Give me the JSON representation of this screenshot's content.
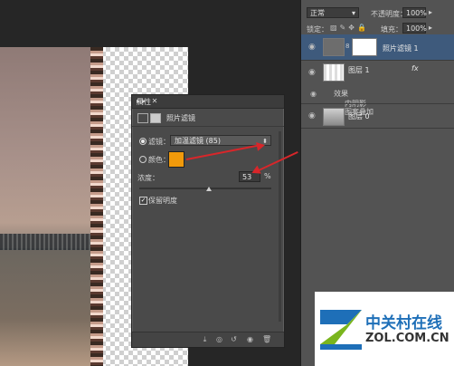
{
  "layers_panel": {
    "blend_mode": "正常",
    "opacity_label": "不透明度：",
    "opacity_value": "100%",
    "lock_label": "锁定：",
    "fill_label": "填充：",
    "fill_value": "100%",
    "layers": [
      {
        "name": "照片滤镜 1"
      },
      {
        "name": "图层 1",
        "fx": "fx",
        "effects_label": "效果",
        "effects": [
          "内阴影",
          "图案叠加"
        ]
      },
      {
        "name": "图层 0"
      }
    ]
  },
  "properties_panel": {
    "title": "属性",
    "panel_controls": "▸▸ ✕",
    "adjustment_title": "照片滤镜",
    "filter_label": "滤镜：",
    "filter_value": "加温滤镜 (85)",
    "color_label": "颜色：",
    "swatch_color": "#f19a0b",
    "density_label": "浓度：",
    "density_value": "53",
    "density_unit": "%",
    "preserve_luminosity_label": "保留明度",
    "preserve_luminosity_checked": true,
    "density_level": 0.53
  },
  "watermark": {
    "name_cn": "中关村在线",
    "name_en": "ZOL.COM.CN"
  },
  "colors": {
    "accent_arrow": "#d8262a",
    "layer_selected": "#3e5a7c",
    "logo_blue": "#1e6fb8",
    "logo_green": "#7ab51d"
  }
}
